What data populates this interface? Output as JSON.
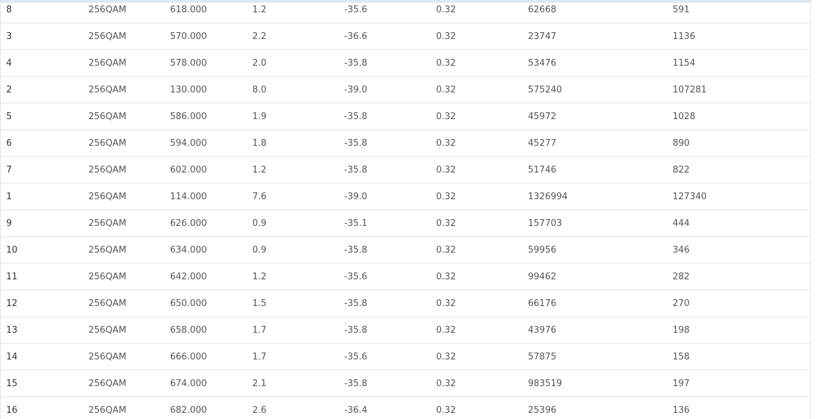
{
  "table": {
    "rows": [
      [
        "8",
        "256QAM",
        "618.000",
        "1.2",
        "-35.6",
        "0.32",
        "62668",
        "591"
      ],
      [
        "3",
        "256QAM",
        "570.000",
        "2.2",
        "-36.6",
        "0.32",
        "23747",
        "1136"
      ],
      [
        "4",
        "256QAM",
        "578.000",
        "2.0",
        "-35.8",
        "0.32",
        "53476",
        "1154"
      ],
      [
        "2",
        "256QAM",
        "130.000",
        "8.0",
        "-39.0",
        "0.32",
        "575240",
        "107281"
      ],
      [
        "5",
        "256QAM",
        "586.000",
        "1.9",
        "-35.8",
        "0.32",
        "45972",
        "1028"
      ],
      [
        "6",
        "256QAM",
        "594.000",
        "1.8",
        "-35.8",
        "0.32",
        "45277",
        "890"
      ],
      [
        "7",
        "256QAM",
        "602.000",
        "1.2",
        "-35.8",
        "0.32",
        "51746",
        "822"
      ],
      [
        "1",
        "256QAM",
        "114.000",
        "7.6",
        "-39.0",
        "0.32",
        "1326994",
        "127340"
      ],
      [
        "9",
        "256QAM",
        "626.000",
        "0.9",
        "-35.1",
        "0.32",
        "157703",
        "444"
      ],
      [
        "10",
        "256QAM",
        "634.000",
        "0.9",
        "-35.8",
        "0.32",
        "59956",
        "346"
      ],
      [
        "11",
        "256QAM",
        "642.000",
        "1.2",
        "-35.6",
        "0.32",
        "99462",
        "282"
      ],
      [
        "12",
        "256QAM",
        "650.000",
        "1.5",
        "-35.8",
        "0.32",
        "66176",
        "270"
      ],
      [
        "13",
        "256QAM",
        "658.000",
        "1.7",
        "-35.8",
        "0.32",
        "43976",
        "198"
      ],
      [
        "14",
        "256QAM",
        "666.000",
        "1.7",
        "-35.6",
        "0.32",
        "57875",
        "158"
      ],
      [
        "15",
        "256QAM",
        "674.000",
        "2.1",
        "-35.8",
        "0.32",
        "983519",
        "197"
      ],
      [
        "16",
        "256QAM",
        "682.000",
        "2.6",
        "-36.4",
        "0.32",
        "25396",
        "136"
      ]
    ]
  }
}
